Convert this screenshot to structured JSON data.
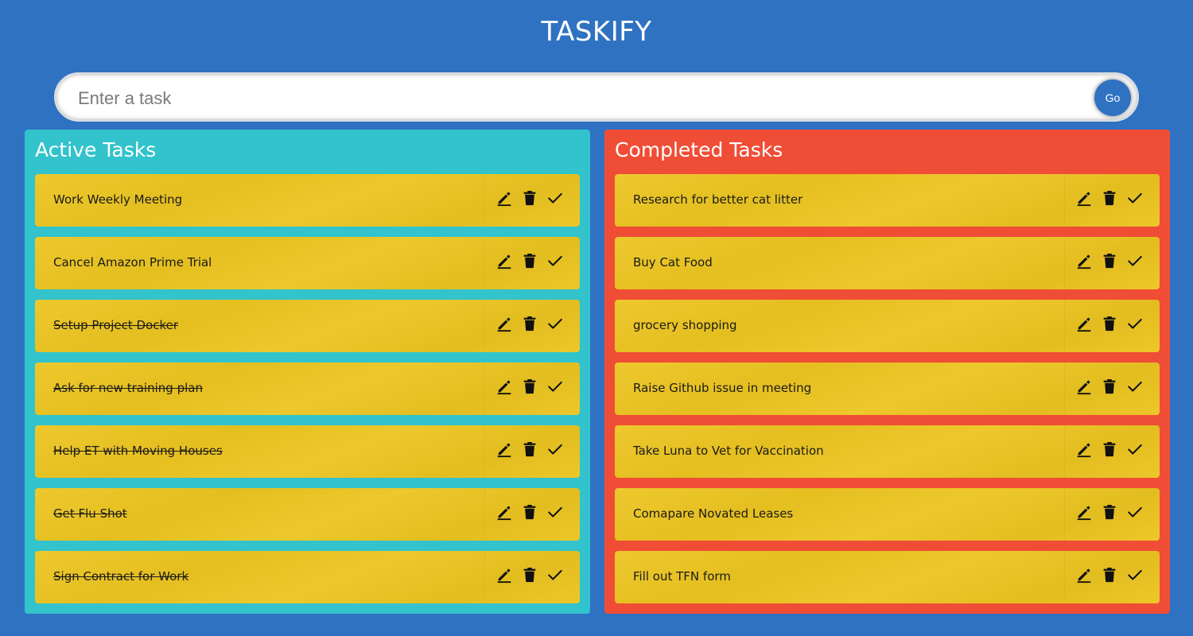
{
  "app": {
    "title": "TASKIFY"
  },
  "task_form": {
    "placeholder": "Enter a task",
    "value": "",
    "submit_label": "Go"
  },
  "active_panel": {
    "title": "Active Tasks",
    "background_color": "#32c3cc",
    "tasks": [
      {
        "text": "Work Weekly Meeting",
        "struck": false
      },
      {
        "text": "Cancel Amazon Prime Trial",
        "struck": false
      },
      {
        "text": "Setup Project Docker",
        "struck": true
      },
      {
        "text": "Ask for new training plan",
        "struck": true
      },
      {
        "text": "Help ET with Moving Houses",
        "struck": true
      },
      {
        "text": "Get Flu Shot",
        "struck": true
      },
      {
        "text": "Sign Contract for Work",
        "struck": true
      }
    ]
  },
  "completed_panel": {
    "title": "Completed Tasks",
    "background_color": "#f04d36",
    "tasks": [
      {
        "text": "Research for better cat litter",
        "struck": false
      },
      {
        "text": "Buy Cat Food",
        "struck": false
      },
      {
        "text": "grocery shopping",
        "struck": false
      },
      {
        "text": "Raise Github issue in meeting",
        "struck": false
      },
      {
        "text": "Take Luna to Vet for Vaccination",
        "struck": false
      },
      {
        "text": "Comapare Novated Leases",
        "struck": false
      },
      {
        "text": "Fill out TFN form",
        "struck": false
      }
    ]
  },
  "task_actions": [
    "edit-icon",
    "delete-icon",
    "done-icon"
  ],
  "colors": {
    "background": "#2f72c2",
    "card": "#ecc521",
    "accent": "#2f72c2"
  }
}
